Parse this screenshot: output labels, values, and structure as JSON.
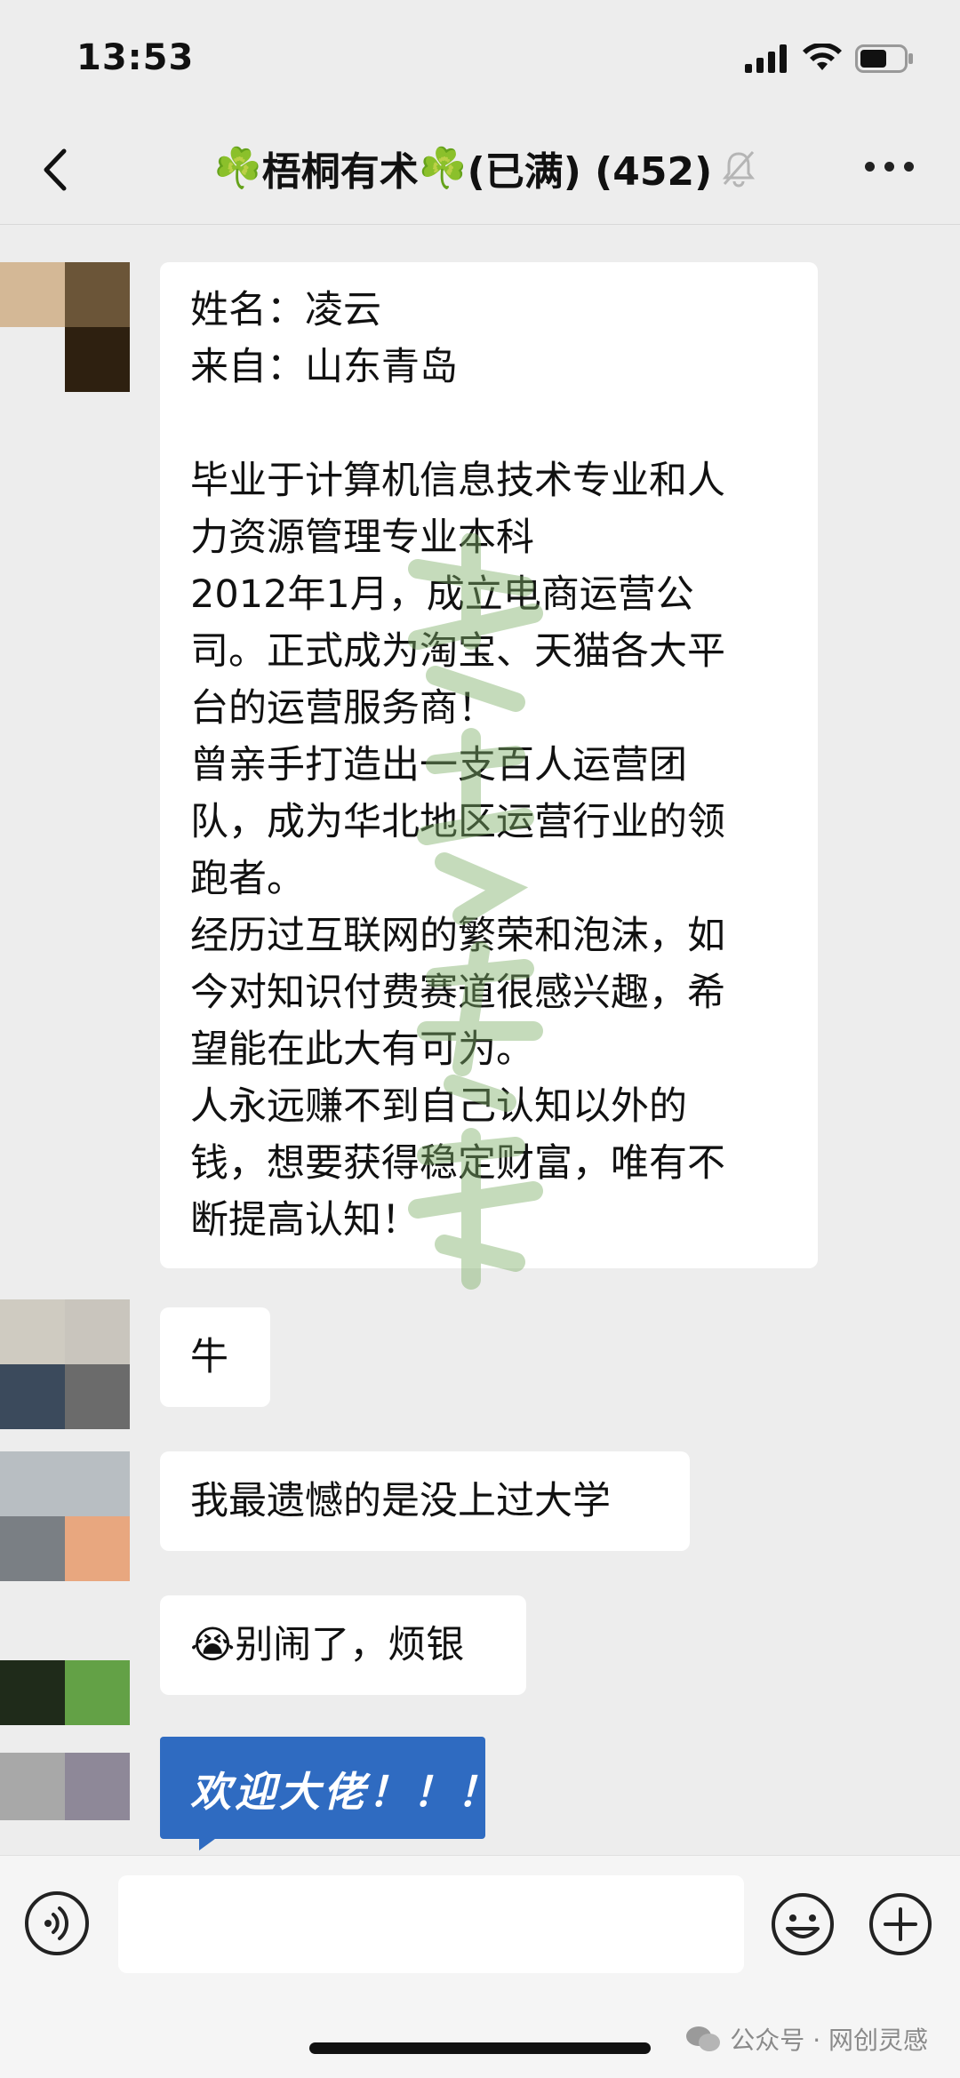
{
  "status_bar": {
    "time": "13:53",
    "battery_level": 0.6
  },
  "nav": {
    "clover": "☘️",
    "title_name": "梧桐有术",
    "title_suffix": "(已满) (452)"
  },
  "messages": [
    {
      "lines": [
        "姓名：凌云",
        "来自：山东青岛",
        "",
        "毕业于计算机信息技术专业和人",
        "力资源管理专业本科",
        "2012年1月，成立电商运营公",
        "司。正式成为淘宝、天猫各大平",
        "台的运营服务商！",
        "曾亲手打造出一支百人运营团",
        "队，成为华北地区运营行业的领",
        "跑者。",
        "经历过互联网的繁荣和泡沫，如",
        "今对知识付费赛道很感兴趣，希",
        "望能在此大有可为。",
        "人永远赚不到自己认知以外的",
        "钱，想要获得稳定财富，唯有不",
        "断提高认知！"
      ]
    },
    {
      "text": "牛"
    },
    {
      "text": "我最遗憾的是没上过大学"
    },
    {
      "emoji": "😭",
      "text": "别闹了，烦银"
    },
    {
      "text": "欢迎大佬！！！"
    }
  ],
  "watermark_bottom": "公众号 · 网创灵感",
  "colors": {
    "background": "#ededed",
    "bubble": "#ffffff",
    "card_blue": "#2f6bc1",
    "watermark_green": "#7fb069"
  }
}
